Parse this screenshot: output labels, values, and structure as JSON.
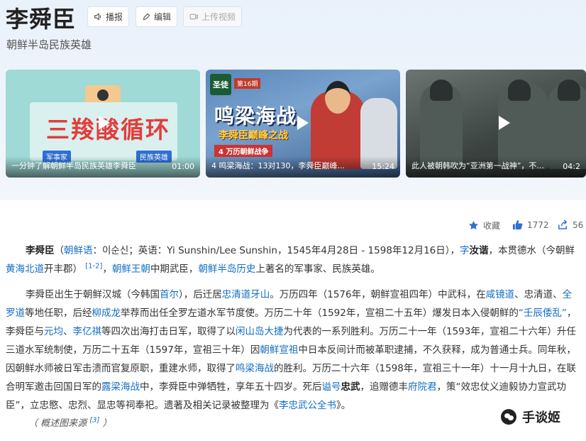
{
  "header": {
    "title": "李舜臣",
    "subtitle": "朝鲜半岛民族英雄",
    "buttons": {
      "broadcast": "播报",
      "edit": "编辑",
      "upload_video": "上传视频"
    }
  },
  "videos": [
    {
      "caption": "一分钟了解朝鲜半岛民族英雄李舜臣",
      "duration": "01:00",
      "thumb_text": "三羧酸循环",
      "tags": [
        "军事家",
        "民族英雄"
      ]
    },
    {
      "caption": "4 鸣梁海战：13对130，李舜臣巅峰...",
      "duration": "15:24",
      "thumb": {
        "logo": "圣徒",
        "episode": "第16期",
        "title": "鸣梁海战",
        "subtitle": "李舜臣巅峰之战",
        "series": "4 万历朝鲜战争"
      }
    },
    {
      "caption": "此人被朝韩吹为“亚洲第一战神”，不...",
      "duration": "04:2"
    }
  ],
  "actions": {
    "favorite": "收藏",
    "likes": "1772",
    "shares": "56"
  },
  "intro": {
    "name": "李舜臣",
    "korean_label": "朝鲜语",
    "korean_name": "이순신",
    "english_label": "英语",
    "english_name": "Yi Sunshin/Lee Sunshin",
    "lifespan": "1545年4月28日 - 1598年12月16日",
    "zi_label": "字",
    "zi": "汝谐",
    "origin_text": "，本贯德水（今朝鲜",
    "origin_link": "黄海北道",
    "origin_tail": "开丰郡）",
    "ref1": "[1-2]",
    "dynasty_link": "朝鲜王朝",
    "mid_text": "中期武臣，",
    "history_link": "朝鲜半岛历史",
    "end_text": "上著名的军事家、民族英雄。"
  },
  "bio": [
    "李舜臣出生于朝鲜汉城（今韩国",
    "首尔",
    "），后迁居",
    "忠清道牙山",
    "。万历四年（1576年，朝鲜宣祖四年）中武科，在",
    "咸镜道",
    "、忠清道、",
    "全罗道",
    "等地任职，后经",
    "柳成龙",
    "举荐而出任全罗左道水军节度使。万历二十年（1592年，宣祖二十五年）爆发日本入侵朝鲜的",
    "“壬辰倭乱”",
    "，李舜臣与",
    "元均",
    "、",
    "李亿祺",
    "等四次出海打击日军，取得了以",
    "闲山岛大捷",
    "为代表的一系列胜利。万历二十一年（1593年，宣祖二十六年）升任三道水军统制使，万历二十五年（1597年，宣祖三十年）因",
    "朝鲜宣祖",
    "中日本反间计而被革职逮捕，不久获释，成为普通士兵。同年秋，因朝鲜水师被日军击溃而官复原职，重建水师，取得了",
    "鸣梁海战",
    "的胜利。万历二十六年（1598年，宣祖三十一年）十一月十九日，在联合明军邀击回国日军的",
    "露梁海战",
    "中，李舜臣中弹牺牲，享年五十四岁。死后",
    "谥号",
    "忠武",
    "，追赠德丰",
    "府院君",
    "，策“效忠仗义迪毅协力宣武功臣”，立忠愍、忠烈、显忠等祠奉祀。遗著及相关记录被整理为《",
    "李忠武公全书",
    "》。"
  ],
  "caption": {
    "text": "（ 概述图来源",
    "ref": "[3]",
    "close": "）"
  },
  "watermark": "手谈姬"
}
